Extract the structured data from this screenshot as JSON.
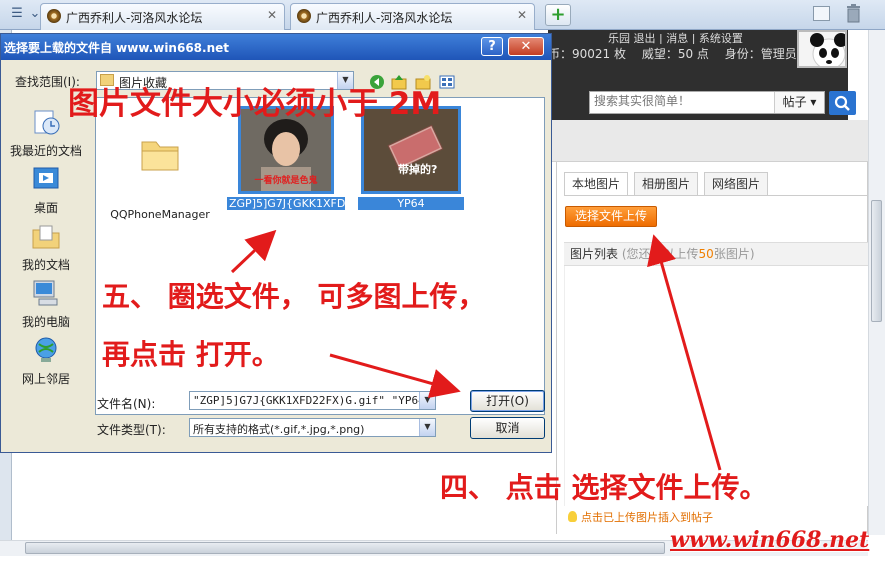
{
  "browser": {
    "tabs": [
      {
        "title": "广西乔利人-河洛风水论坛",
        "close": "✕"
      },
      {
        "title": "广西乔利人-河洛风水论坛",
        "close": "✕"
      }
    ],
    "add_tab": "+"
  },
  "forum": {
    "top_links": "乐园 退出 | 消息 | 系统设置",
    "stats": [
      "币：90021 枚",
      "威望：50 点",
      "身份：管理员"
    ],
    "search": {
      "placeholder": "搜索其实很简单！",
      "type": "帖子"
    },
    "tabs": [
      "本地图片",
      "相册图片",
      "网络图片"
    ],
    "choose_button": "选择文件上传",
    "list_header": {
      "title": "图片列表",
      "hint_prefix": "(您还可以上传",
      "hint_number": "50",
      "hint_suffix": "张图片)"
    },
    "insert_tip": "点击已上传图片插入到帖子"
  },
  "dialog": {
    "title": "选择要上载的文件自 www.win668.net",
    "help": "?",
    "close": "✕",
    "look_in_label": "查找范围(I):",
    "look_in_value": "图片收藏",
    "places": [
      "我最近的文档",
      "桌面",
      "我的文档",
      "我的电脑",
      "网上邻居"
    ],
    "files": [
      {
        "name": "QQPhoneManager",
        "thumb_text": ""
      },
      {
        "name": "ZGP]5]G7J{GKK1XFD22FX)G",
        "thumb_text": "一看你就是色鬼"
      },
      {
        "name": "YP64",
        "thumb_text": "带掉的?"
      }
    ],
    "filename_label": "文件名(N):",
    "filename_value": "\"ZGP]5]G7J{GKK1XFD22FX)G.gif\" \"YP64.jpg\"",
    "filetype_label": "文件类型(T):",
    "filetype_value": "所有支持的格式(*.gif,*.jpg,*.png)",
    "open_button": "打开(O)",
    "cancel_button": "取消"
  },
  "annotations": {
    "size_note": "图片文件大小必须小于 2M",
    "step5": "五、 圈选文件， 可多图上传，",
    "open_note": "再点击 打开。",
    "step4": "四、 点击 选择文件上传。"
  },
  "watermark": "www.win668.net",
  "colors": {
    "annotation": "#e21b1b",
    "upload_button": "#f07f00",
    "selection": "#3a86d9",
    "xp_title": "#1f55b8"
  }
}
